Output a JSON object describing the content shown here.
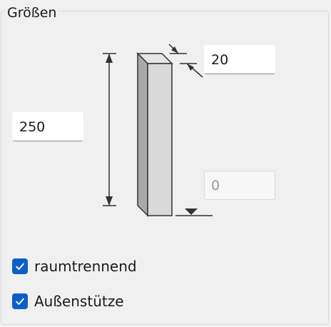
{
  "group": {
    "title": "Größen"
  },
  "fields": {
    "thickness": "20",
    "height": "250",
    "offset": "0"
  },
  "checkboxes": [
    {
      "label": "raumtrennend",
      "checked": true
    },
    {
      "label": "Außenstütze",
      "checked": true
    }
  ],
  "colors": {
    "accent": "#0a5fc7",
    "column_front": "#d9d9d9",
    "column_side": "#a9a9a9"
  }
}
